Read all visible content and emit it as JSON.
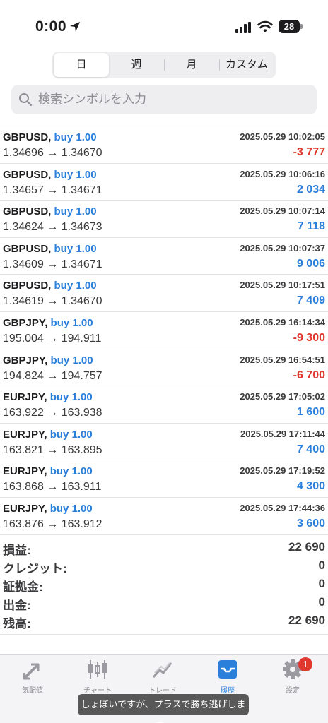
{
  "status_bar": {
    "time": "0:00",
    "battery": "28"
  },
  "period_tabs": [
    {
      "label": "日",
      "active": true
    },
    {
      "label": "週",
      "active": false
    },
    {
      "label": "月",
      "active": false
    },
    {
      "label": "カスタム",
      "active": false
    }
  ],
  "search": {
    "placeholder": "検索シンボルを入力",
    "value": ""
  },
  "trades": [
    {
      "symbol": "GBPUSD,",
      "side": "buy 1.00",
      "time": "2025.05.29 10:02:05",
      "prices": "1.34696 → 1.34670",
      "profit": "-3 777",
      "profit_sign": "neg"
    },
    {
      "symbol": "GBPUSD,",
      "side": "buy 1.00",
      "time": "2025.05.29 10:06:16",
      "prices": "1.34657 → 1.34671",
      "profit": "2 034",
      "profit_sign": "pos"
    },
    {
      "symbol": "GBPUSD,",
      "side": "buy 1.00",
      "time": "2025.05.29 10:07:14",
      "prices": "1.34624 → 1.34673",
      "profit": "7 118",
      "profit_sign": "pos"
    },
    {
      "symbol": "GBPUSD,",
      "side": "buy 1.00",
      "time": "2025.05.29 10:07:37",
      "prices": "1.34609 → 1.34671",
      "profit": "9 006",
      "profit_sign": "pos"
    },
    {
      "symbol": "GBPUSD,",
      "side": "buy 1.00",
      "time": "2025.05.29 10:17:51",
      "prices": "1.34619 → 1.34670",
      "profit": "7 409",
      "profit_sign": "pos"
    },
    {
      "symbol": "GBPJPY,",
      "side": "buy 1.00",
      "time": "2025.05.29 16:14:34",
      "prices": "195.004 → 194.911",
      "profit": "-9 300",
      "profit_sign": "neg"
    },
    {
      "symbol": "GBPJPY,",
      "side": "buy 1.00",
      "time": "2025.05.29 16:54:51",
      "prices": "194.824 → 194.757",
      "profit": "-6 700",
      "profit_sign": "neg"
    },
    {
      "symbol": "EURJPY,",
      "side": "buy 1.00",
      "time": "2025.05.29 17:05:02",
      "prices": "163.922 → 163.938",
      "profit": "1 600",
      "profit_sign": "pos"
    },
    {
      "symbol": "EURJPY,",
      "side": "buy 1.00",
      "time": "2025.05.29 17:11:44",
      "prices": "163.821 → 163.895",
      "profit": "7 400",
      "profit_sign": "pos"
    },
    {
      "symbol": "EURJPY,",
      "side": "buy 1.00",
      "time": "2025.05.29 17:19:52",
      "prices": "163.868 → 163.911",
      "profit": "4 300",
      "profit_sign": "pos"
    },
    {
      "symbol": "EURJPY,",
      "side": "buy 1.00",
      "time": "2025.05.29 17:44:36",
      "prices": "163.876 → 163.912",
      "profit": "3 600",
      "profit_sign": "pos"
    }
  ],
  "summary": [
    {
      "label": "損益:",
      "value": "22 690"
    },
    {
      "label": "クレジット:",
      "value": "0"
    },
    {
      "label": "証拠金:",
      "value": "0"
    },
    {
      "label": "出金:",
      "value": "0"
    },
    {
      "label": "残高:",
      "value": "22 690"
    }
  ],
  "tab_bar": {
    "items": [
      {
        "label": "気配値",
        "icon": "quotes-icon",
        "active": false
      },
      {
        "label": "チャート",
        "icon": "chart-icon",
        "active": false
      },
      {
        "label": "トレード",
        "icon": "trade-icon",
        "active": false
      },
      {
        "label": "履歴",
        "icon": "history-icon",
        "active": true
      },
      {
        "label": "設定",
        "icon": "settings-icon",
        "active": false
      }
    ],
    "settings_badge": "1"
  },
  "toast": "しょぼいですが、プラスで勝ち逃げします。",
  "colors": {
    "accent": "#2a7fdb",
    "negative": "#e0382e",
    "text": "#1c1c1e",
    "muted": "#8e8e93"
  }
}
